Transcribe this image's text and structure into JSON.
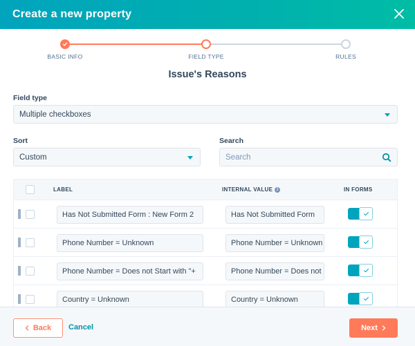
{
  "header": {
    "title": "Create a new property",
    "close_icon": "close-icon"
  },
  "steps": [
    {
      "label": "BASIC INFO",
      "state": "completed"
    },
    {
      "label": "FIELD TYPE",
      "state": "active"
    },
    {
      "label": "RULES",
      "state": "pending"
    }
  ],
  "section_title": "Issue's Reasons",
  "field_type": {
    "label": "Field type",
    "value": "Multiple checkboxes"
  },
  "sort": {
    "label": "Sort",
    "value": "Custom"
  },
  "search": {
    "label": "Search",
    "placeholder": "Search",
    "value": ""
  },
  "table": {
    "columns": {
      "label": "LABEL",
      "internal_value": "INTERNAL VALUE",
      "in_forms": "IN FORMS"
    },
    "rows": [
      {
        "label": "Has Not Submitted Form : New Form 2",
        "internal_value": "Has Not Submitted Form",
        "in_forms": true,
        "selected": false
      },
      {
        "label": "Phone Number = Unknown",
        "internal_value": "Phone Number = Unknown",
        "in_forms": true,
        "selected": false
      },
      {
        "label": "Phone Number = Does not Start with \"+",
        "internal_value": "Phone Number = Does not",
        "in_forms": true,
        "selected": false
      },
      {
        "label": "Country = Unknown",
        "internal_value": "Country = Unknown",
        "in_forms": true,
        "selected": false
      }
    ]
  },
  "footer": {
    "back_label": "Back",
    "cancel_label": "Cancel",
    "next_label": "Next"
  },
  "colors": {
    "accent": "#ff7a59",
    "primary": "#00a4bd",
    "header_gradient_start": "#00a4bd",
    "header_gradient_end": "#00bda5"
  }
}
